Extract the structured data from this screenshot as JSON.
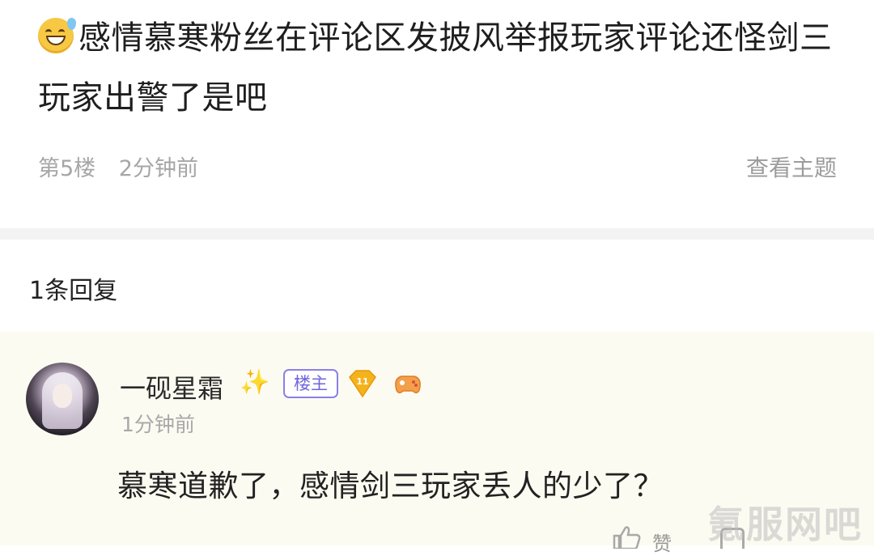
{
  "post": {
    "text": "感情慕寒粉丝在评论区发披风举报玩家评论还怪剑三玩家出警了是吧",
    "emoji_icon": "sweat-smile-emoji",
    "floor": "第5楼",
    "time": "2分钟前",
    "view_topic_label": "查看主题"
  },
  "replies_header": {
    "count_label": "1条回复"
  },
  "reply": {
    "username": "一砚星霜",
    "name_decoration": "✨",
    "owner_badge": "楼主",
    "level": "11",
    "time": "1分钟前",
    "text": "慕寒道歉了，感情剑三玩家丢人的少了？",
    "like_label": "赞"
  },
  "watermark": "氪服网吧",
  "colors": {
    "owner_badge": "#6f65de",
    "level_badge": "#f5b21b",
    "reply_background": "#fcfbf1",
    "meta_text": "#a6a6a6"
  }
}
